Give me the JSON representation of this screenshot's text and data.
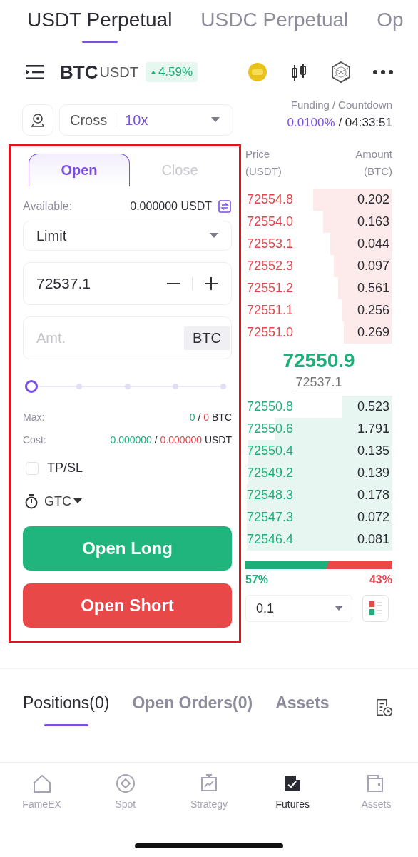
{
  "market_tabs": [
    {
      "label": "USDT Perpetual",
      "selected": true
    },
    {
      "label": "USDC Perpetual",
      "selected": false
    },
    {
      "label": "Op",
      "selected": false
    }
  ],
  "pair": {
    "base": "BTC",
    "quote": "USDT",
    "change": "4.59%"
  },
  "margin": {
    "mode": "Cross",
    "leverage": "10x"
  },
  "funding": {
    "label": "Funding",
    "separator": "/",
    "countdown_label": "Countdown",
    "rate": "0.0100%",
    "time_separator": "/",
    "time": "04:33:51"
  },
  "order_form": {
    "tabs": [
      {
        "label": "Open",
        "selected": true
      },
      {
        "label": "Close",
        "selected": false
      }
    ],
    "available_label": "Available:",
    "available_value": "0.000000 USDT",
    "order_type": "Limit",
    "price": "72537.1",
    "amount_placeholder": "Amt.",
    "amount_unit": "BTC",
    "slider": {
      "level": 0
    },
    "max_label": "Max:",
    "max_long": "0",
    "max_sep": "/",
    "max_short": "0",
    "max_unit": "BTC",
    "cost_label": "Cost:",
    "cost_long": "0.000000",
    "cost_sep": "/",
    "cost_short": "0.000000",
    "cost_unit": "USDT",
    "tpsl": {
      "label": "TP/SL",
      "checked": false
    },
    "time_in_force": "GTC",
    "buttons": [
      {
        "label": "Open Long",
        "kind": "long"
      },
      {
        "label": "Open Short",
        "kind": "short"
      }
    ]
  },
  "order_book": {
    "price_header": "Price",
    "price_unit": "(USDT)",
    "amount_header": "Amount",
    "amount_unit": "(BTC)",
    "asks": [
      {
        "price": "72554.8",
        "amount": "0.202"
      },
      {
        "price": "72554.0",
        "amount": "0.163"
      },
      {
        "price": "72553.1",
        "amount": "0.044"
      },
      {
        "price": "72552.3",
        "amount": "0.097"
      },
      {
        "price": "72551.2",
        "amount": "0.561"
      },
      {
        "price": "72551.1",
        "amount": "0.256"
      },
      {
        "price": "72551.0",
        "amount": "0.269"
      }
    ],
    "last_price": "72550.9",
    "mark_price": "72537.1",
    "bids": [
      {
        "price": "72550.8",
        "amount": "0.523"
      },
      {
        "price": "72550.6",
        "amount": "1.791"
      },
      {
        "price": "72550.4",
        "amount": "0.135"
      },
      {
        "price": "72549.2",
        "amount": "0.139"
      },
      {
        "price": "72548.3",
        "amount": "0.178"
      },
      {
        "price": "72547.3",
        "amount": "0.072"
      },
      {
        "price": "72546.4",
        "amount": "0.081"
      }
    ],
    "buy_ratio": {
      "level": 0.57
    },
    "buy_percent": "57%",
    "sell_percent": "43%",
    "precision": "0.1"
  },
  "position_tabs": [
    {
      "label": "Positions(0)",
      "selected": true
    },
    {
      "label": "Open Orders(0)",
      "selected": false
    },
    {
      "label": "Assets",
      "selected": false
    }
  ],
  "bottom_nav": [
    {
      "label": "FameEX",
      "selected": false
    },
    {
      "label": "Spot",
      "selected": false
    },
    {
      "label": "Strategy",
      "selected": false
    },
    {
      "label": "Futures",
      "selected": true
    },
    {
      "label": "Assets",
      "selected": false
    }
  ]
}
